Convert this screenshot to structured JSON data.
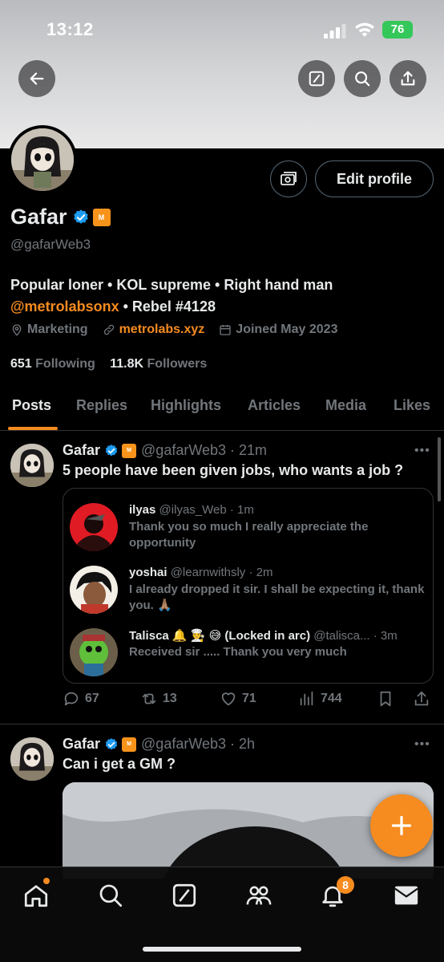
{
  "status_bar": {
    "time": "13:12",
    "battery": "76"
  },
  "profile": {
    "name": "Gafar",
    "handle": "@gafarWeb3",
    "affiliate_badge": "M",
    "edit_label": "Edit profile",
    "bio_line1": "Popular loner • KOL supreme • Right hand man",
    "bio_mention": "@metrolabsonx",
    "bio_rest": " • Rebel #4128",
    "location": "Marketing",
    "website": "metrolabs.xyz",
    "joined": "Joined May 2023",
    "following_count": "651",
    "following_label": "Following",
    "followers_count": "11.8K",
    "followers_label": "Followers"
  },
  "tabs": [
    "Posts",
    "Replies",
    "Highlights",
    "Articles",
    "Media",
    "Likes"
  ],
  "posts": [
    {
      "name": "Gafar",
      "meta": "@gafarWeb3 · 21m",
      "text": "5 people have been given jobs, who wants a job ?",
      "replies": [
        {
          "name": "ilyas",
          "handle": "@ilyas_Web · 1m",
          "text": "Thank you so much I really appreciate the opportunity"
        },
        {
          "name": "yoshai",
          "handle": "@learnwithsly · 2m",
          "text": "I already dropped it sir. I shall be expecting it, thank you. 🙏🏽"
        },
        {
          "name": "Talisca 🔔 👨‍🍳 😅 (Locked in arc)",
          "handle": "@talisca...",
          "time": "· 3m",
          "text": "Received sir ..... Thank you very much"
        }
      ],
      "stats": {
        "replies": "67",
        "reposts": "13",
        "likes": "71",
        "views": "744"
      }
    },
    {
      "name": "Gafar",
      "meta": "@gafarWeb3 · 2h",
      "text": "Can i get a GM ?"
    }
  ],
  "more_glyph": "•••",
  "nav": {
    "notification_count": "8"
  },
  "colors": {
    "accent": "#f68b1f",
    "verified": "#1d9bf0",
    "muted": "#71767b",
    "background": "#000000"
  }
}
